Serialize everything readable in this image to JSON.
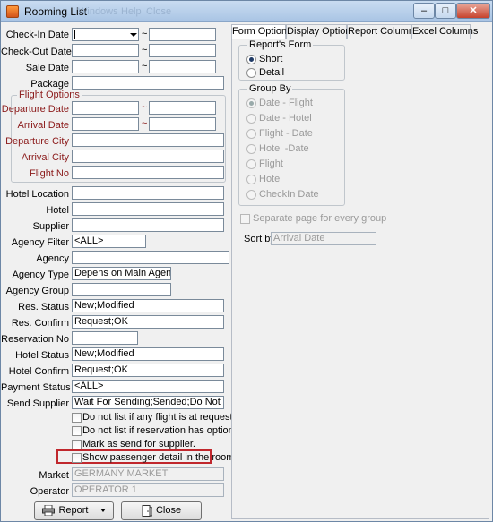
{
  "window": {
    "title": "Rooming List",
    "ghost_menu": [
      "Windows",
      "Help",
      "Close"
    ],
    "controls": {
      "minimize": "–",
      "maximize": "□",
      "close": "✕"
    }
  },
  "form": {
    "checkin_label": "Check-In Date",
    "checkout_label": "Check-Out Date",
    "sale_label": "Sale Date",
    "package_label": "Package",
    "range_sep": "~",
    "flight_group_title": "Flight Options",
    "departure_date_label": "Departure Date",
    "arrival_date_label": "Arrival Date",
    "departure_city_label": "Departure City",
    "arrival_city_label": "Arrival City",
    "flight_no_label": "Flight No",
    "hotel_location_label": "Hotel Location",
    "hotel_label": "Hotel",
    "supplier_label": "Supplier",
    "agency_filter_label": "Agency Filter",
    "agency_filter_value": "<ALL>",
    "agency_label": "Agency",
    "agency_type_label": "Agency Type",
    "agency_type_value": "Depens on Main Agency",
    "agency_group_label": "Agency Group",
    "res_status_label": "Res. Status",
    "res_status_value": "New;Modified",
    "res_confirm_label": "Res. Confirm",
    "res_confirm_value": "Request;OK",
    "reservation_no_label": "Reservation No",
    "hotel_status_label": "Hotel Status",
    "hotel_status_value": "New;Modified",
    "hotel_confirm_label": "Hotel Confirm",
    "hotel_confirm_value": "Request;OK",
    "payment_status_label": "Payment Status",
    "payment_status_value": "<ALL>",
    "send_supplier_label": "Send Supplier",
    "send_supplier_value": "Wait For Sending;Sended;Do Not Send",
    "checks": [
      "Do not list if any flight is at request.",
      "Do not list if reservation has option date.",
      "Mark as send for supplier.",
      "Show passenger detail in the rooms"
    ],
    "market_label": "Market",
    "market_value": "GERMANY MARKET",
    "operator_label": "Operator",
    "operator_value": "OPERATOR 1"
  },
  "buttons": {
    "report": "Report",
    "close": "Close"
  },
  "tabs": [
    "Form Options",
    "Display Options",
    "Report Columns",
    "Excel Columns"
  ],
  "options": {
    "reports_form_title": "Report's Form",
    "short": "Short",
    "detail": "Detail",
    "group_by_title": "Group By",
    "group_by": [
      "Date - Flight",
      "Date - Hotel",
      "Flight - Date",
      "Hotel -Date",
      "Flight",
      "Hotel",
      "CheckIn Date"
    ],
    "separate_page": "Separate page for every group",
    "sort_by_label": "Sort by",
    "sort_by_value": "Arrival Date"
  },
  "colors": {
    "highlight": "#c0272d",
    "flight_label": "#8b1a1a"
  }
}
